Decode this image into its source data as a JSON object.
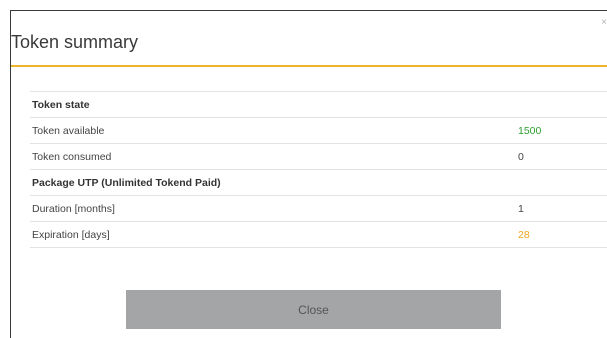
{
  "dialog": {
    "title": "Token summary",
    "close_icon": "×",
    "close_button_label": "Close"
  },
  "table": {
    "rows": [
      {
        "label": "Token state",
        "value": "",
        "kind": "section"
      },
      {
        "label": "Token available",
        "value": "1500",
        "kind": "item",
        "value_color": "#2e9e2e"
      },
      {
        "label": "Token consumed",
        "value": "0",
        "kind": "item"
      },
      {
        "label": "Package UTP (Unlimited Tokend Paid)",
        "value": "",
        "kind": "section"
      },
      {
        "label": "Duration [months]",
        "value": "1",
        "kind": "item"
      },
      {
        "label": "Expiration [days]",
        "value": "28",
        "kind": "item",
        "value_color": "#f0a51f"
      }
    ]
  },
  "colors": {
    "accent_underline": "#f0b429",
    "button_bg": "#a3a5a7"
  }
}
